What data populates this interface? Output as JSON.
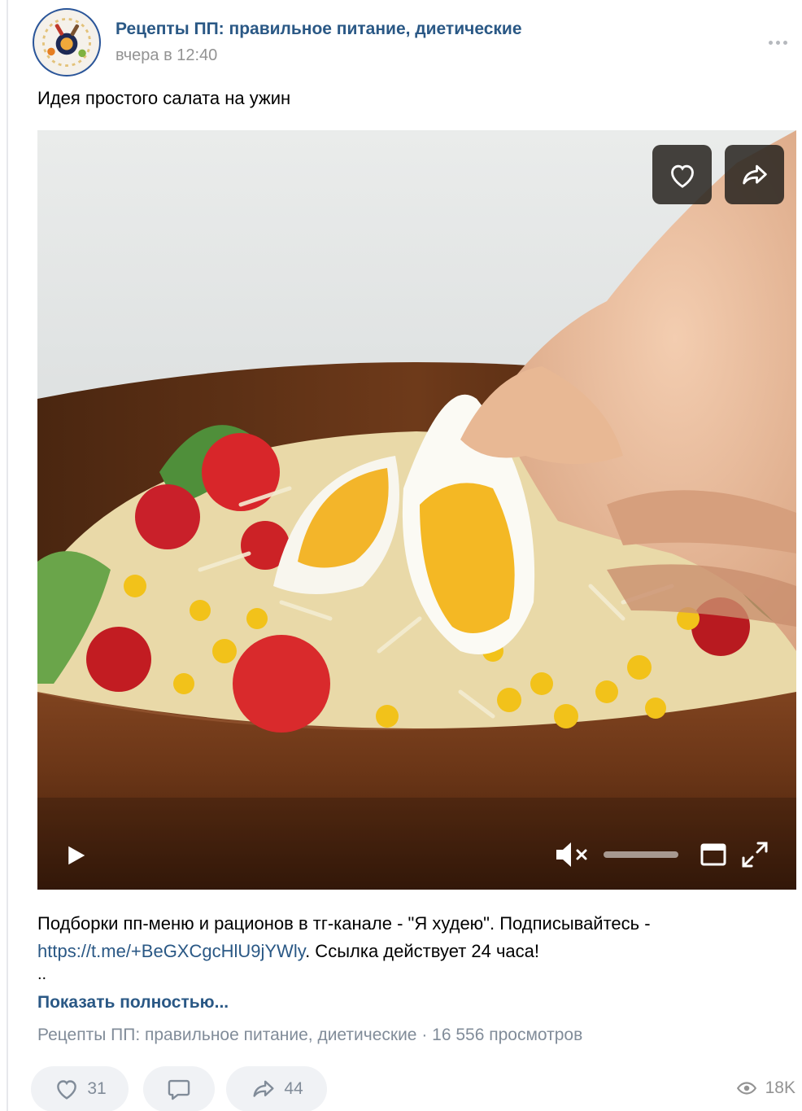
{
  "post": {
    "author": "Рецепты ПП: правильное питание, диетические",
    "time": "вчера в 12:40",
    "text": "Идея простого салата на ужин"
  },
  "video": {
    "volume_level": 0.0,
    "muted": true
  },
  "description": {
    "line1": "Подборки пп-меню и рационов в тг-канале - \"Я худею\". Подписывайтесь -",
    "link": "https://t.me/+BeGXCgcHlU9jYWly",
    "after_link": ". Ссылка действует 24 часа!",
    "ellipsis": "..",
    "show_more": "Показать полностью..."
  },
  "source": {
    "text": "Рецепты ПП: правильное питание, диетические · 16 556 просмотров"
  },
  "actions": {
    "likes": "31",
    "shares": "44",
    "views": "18K"
  },
  "colors": {
    "link": "#2a5885",
    "muted_text": "#818c99",
    "pill_bg": "#f0f2f5"
  },
  "icons": [
    "more-icon",
    "heart-icon",
    "share-icon",
    "play-icon",
    "mute-icon",
    "miniplayer-icon",
    "fullscreen-icon",
    "comment-icon",
    "eye-icon"
  ]
}
